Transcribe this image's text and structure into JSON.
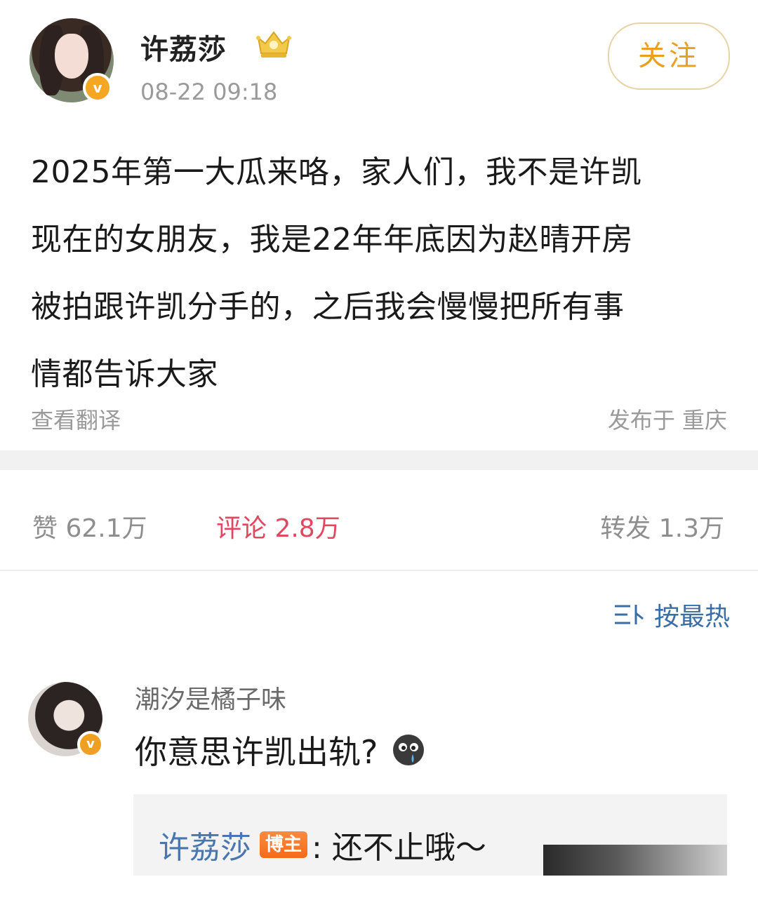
{
  "post": {
    "author": "许荔莎",
    "time": "08-22 09:18",
    "follow_label": "关注",
    "badge_text": "v",
    "body_lines": [
      "2025年第一大瓜来咯，家人们，我不是许凯",
      "现在的女朋友，我是22年年底因为赵晴开房",
      "被拍跟许凯分手的，之后我会慢慢把所有事",
      "情都告诉大家"
    ],
    "translate_label": "查看翻译",
    "location_label": "发布于 重庆"
  },
  "stats": {
    "likes": "赞 62.1万",
    "comments": "评论 2.8万",
    "reposts": "转发 1.3万"
  },
  "sort": {
    "label": "按最热"
  },
  "comment": {
    "author": "潮汐是橘子味",
    "badge_text": "v",
    "text": "你意思许凯出轨?",
    "reply": {
      "author": "许荔莎",
      "host_badge": "博主",
      "text": ": 还不止哦～"
    }
  }
}
